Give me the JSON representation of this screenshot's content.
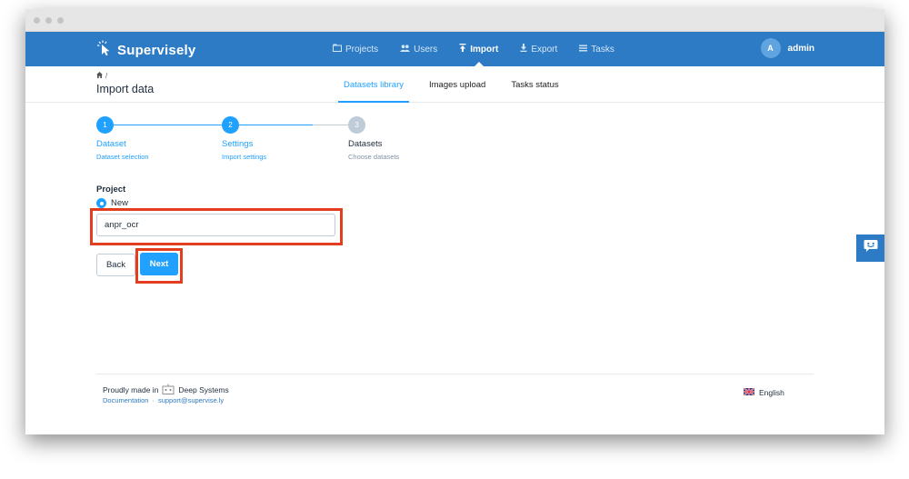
{
  "app": {
    "brand": "Supervisely",
    "nav": [
      {
        "label": "Projects",
        "icon": "projects-icon",
        "active": false
      },
      {
        "label": "Users",
        "icon": "users-icon",
        "active": false
      },
      {
        "label": "Import",
        "icon": "import-icon",
        "active": true
      },
      {
        "label": "Export",
        "icon": "export-icon",
        "active": false
      },
      {
        "label": "Tasks",
        "icon": "tasks-icon",
        "active": false
      }
    ],
    "user": {
      "avatar_letter": "A",
      "name": "admin"
    }
  },
  "page": {
    "breadcrumb_sep": "/",
    "title": "Import data",
    "tabs": [
      {
        "label": "Datasets library",
        "active": true
      },
      {
        "label": "Images upload",
        "active": false
      },
      {
        "label": "Tasks status",
        "active": false
      }
    ]
  },
  "steps": [
    {
      "number": "1",
      "title": "Dataset",
      "description": "Dataset selection",
      "state": "done"
    },
    {
      "number": "2",
      "title": "Settings",
      "description": "Import settings",
      "state": "active"
    },
    {
      "number": "3",
      "title": "Datasets",
      "description": "Choose datasets",
      "state": "pending"
    }
  ],
  "form": {
    "project_label": "Project",
    "radio_label": "New",
    "project_name_value": "anpr_ocr",
    "back_label": "Back",
    "next_label": "Next"
  },
  "footer": {
    "made_in": "Proudly made in",
    "company": "Deep Systems",
    "documentation": "Documentation",
    "separator": "·",
    "support_email": "support@supervise.ly",
    "language": "English"
  },
  "colors": {
    "primary": "#20a0ff",
    "nav_bg": "#2d7bc4",
    "highlight": "#e23d1f",
    "pending": "#bfcbd9"
  }
}
